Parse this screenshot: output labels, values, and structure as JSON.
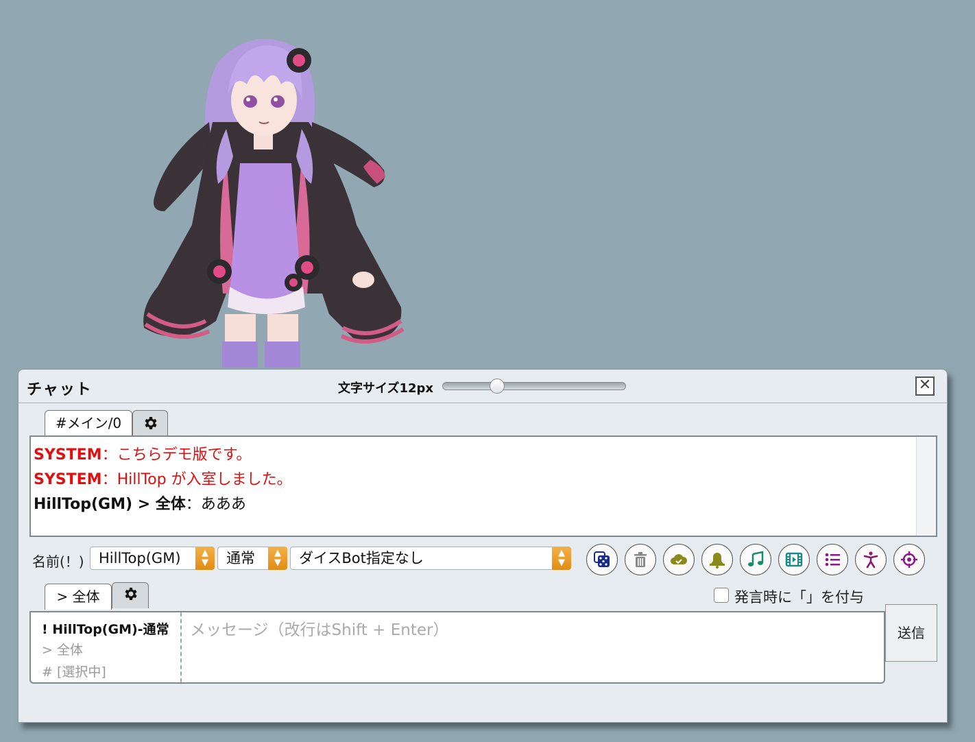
{
  "window": {
    "title": "チャット",
    "font_size_label": "文字サイズ12px",
    "font_size_value": 12,
    "close_symbol": "✕"
  },
  "log_tabs": [
    {
      "label": "#メイン/0"
    }
  ],
  "messages": [
    {
      "speaker": "SYSTEM",
      "sep": "：",
      "text": "こちらデモ版です。",
      "color": "#e01010"
    },
    {
      "speaker": "SYSTEM",
      "sep": "：",
      "text": "HillTop が入室しました。",
      "color": "#e01010"
    },
    {
      "speaker": "HillTop(GM) > 全体",
      "sep": "：",
      "text": "あああ",
      "color": "#111111"
    }
  ],
  "controls": {
    "name_label": "名前(！)",
    "name_select": "HillTop(GM)",
    "status_select": "通常",
    "dicebot_select": "ダイスBot指定なし",
    "icons": [
      "dice-icon",
      "trash-icon",
      "cloud-icon",
      "bell-icon",
      "music-icon",
      "film-icon",
      "list-icon",
      "figure-icon",
      "target-icon"
    ]
  },
  "input": {
    "target_tab": "> 全体",
    "quote_label": "発言時に「」を付与",
    "speakers": [
      "! HillTop(GM)-通常",
      "> 全体",
      "# [選択中]"
    ],
    "placeholder": "メッセージ（改行はShift + Enter）",
    "send_label": "送信"
  }
}
